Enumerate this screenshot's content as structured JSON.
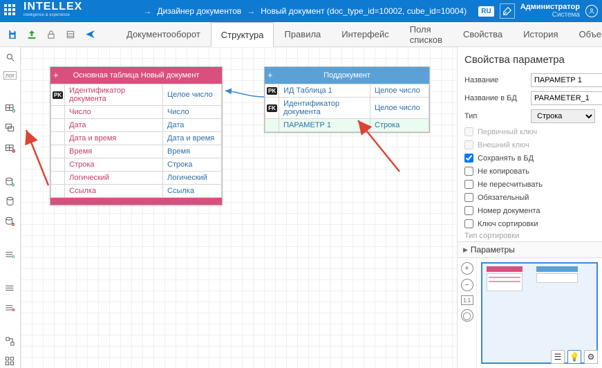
{
  "header": {
    "logo": "INTELLEX",
    "logo_sub": "intelligence & experience",
    "breadcrumb": [
      "Дизайнер документов",
      "Новый документ (doc_type_id=10002, cube_id=10004)"
    ],
    "lang": "RU",
    "user_name": "Администратор",
    "user_role": "Система"
  },
  "tabs": [
    "Документооборот",
    "Структура",
    "Правила",
    "Интерфейс",
    "Поля списков",
    "Свойства",
    "История",
    "Объекты"
  ],
  "tabs_active_index": 1,
  "log_label": "лог",
  "table1": {
    "title": "Основная таблица Новый документ",
    "rows": [
      {
        "key": "PK",
        "name": "Идентификатор документа",
        "type": "Целое число"
      },
      {
        "key": "",
        "name": "Число",
        "type": "Число"
      },
      {
        "key": "",
        "name": "Дата",
        "type": "Дата"
      },
      {
        "key": "",
        "name": "Дата и время",
        "type": "Дата и время"
      },
      {
        "key": "",
        "name": "Время",
        "type": "Время"
      },
      {
        "key": "",
        "name": "Строка",
        "type": "Строка"
      },
      {
        "key": "",
        "name": "Логический",
        "type": "Логический"
      },
      {
        "key": "",
        "name": "Ссылка",
        "type": "Ссылка"
      }
    ]
  },
  "table2": {
    "title": "Поддокумент",
    "rows": [
      {
        "key": "PK",
        "name": "ИД Таблица 1",
        "type": "Целое число",
        "hl": false
      },
      {
        "key": "FK",
        "name": "Идентификатор документа",
        "type": "Целое число",
        "hl": false
      },
      {
        "key": "",
        "name": "ПАРАМЕТР 1",
        "type": "Строка",
        "hl": true
      }
    ]
  },
  "panel": {
    "title": "Свойства параметра",
    "labels": {
      "name": "Название",
      "db_name": "Название в БД",
      "type": "Тип",
      "primary": "Первичный ключ",
      "foreign": "Внешний ключ",
      "save_db": "Сохранять в БД",
      "no_copy": "Не копировать",
      "no_recalc": "Не пересчитывать",
      "required": "Обязательный",
      "doc_num": "Номер документа",
      "sort_key": "Ключ сортировки",
      "sort_type": "Тип сортировки",
      "section_params": "Параметры"
    },
    "values": {
      "name": "ПАРАМЕТР 1",
      "db_name": "PARAMETER_1",
      "type": "Строка",
      "save_db": true
    }
  },
  "minimap_tool_11": "1:1"
}
